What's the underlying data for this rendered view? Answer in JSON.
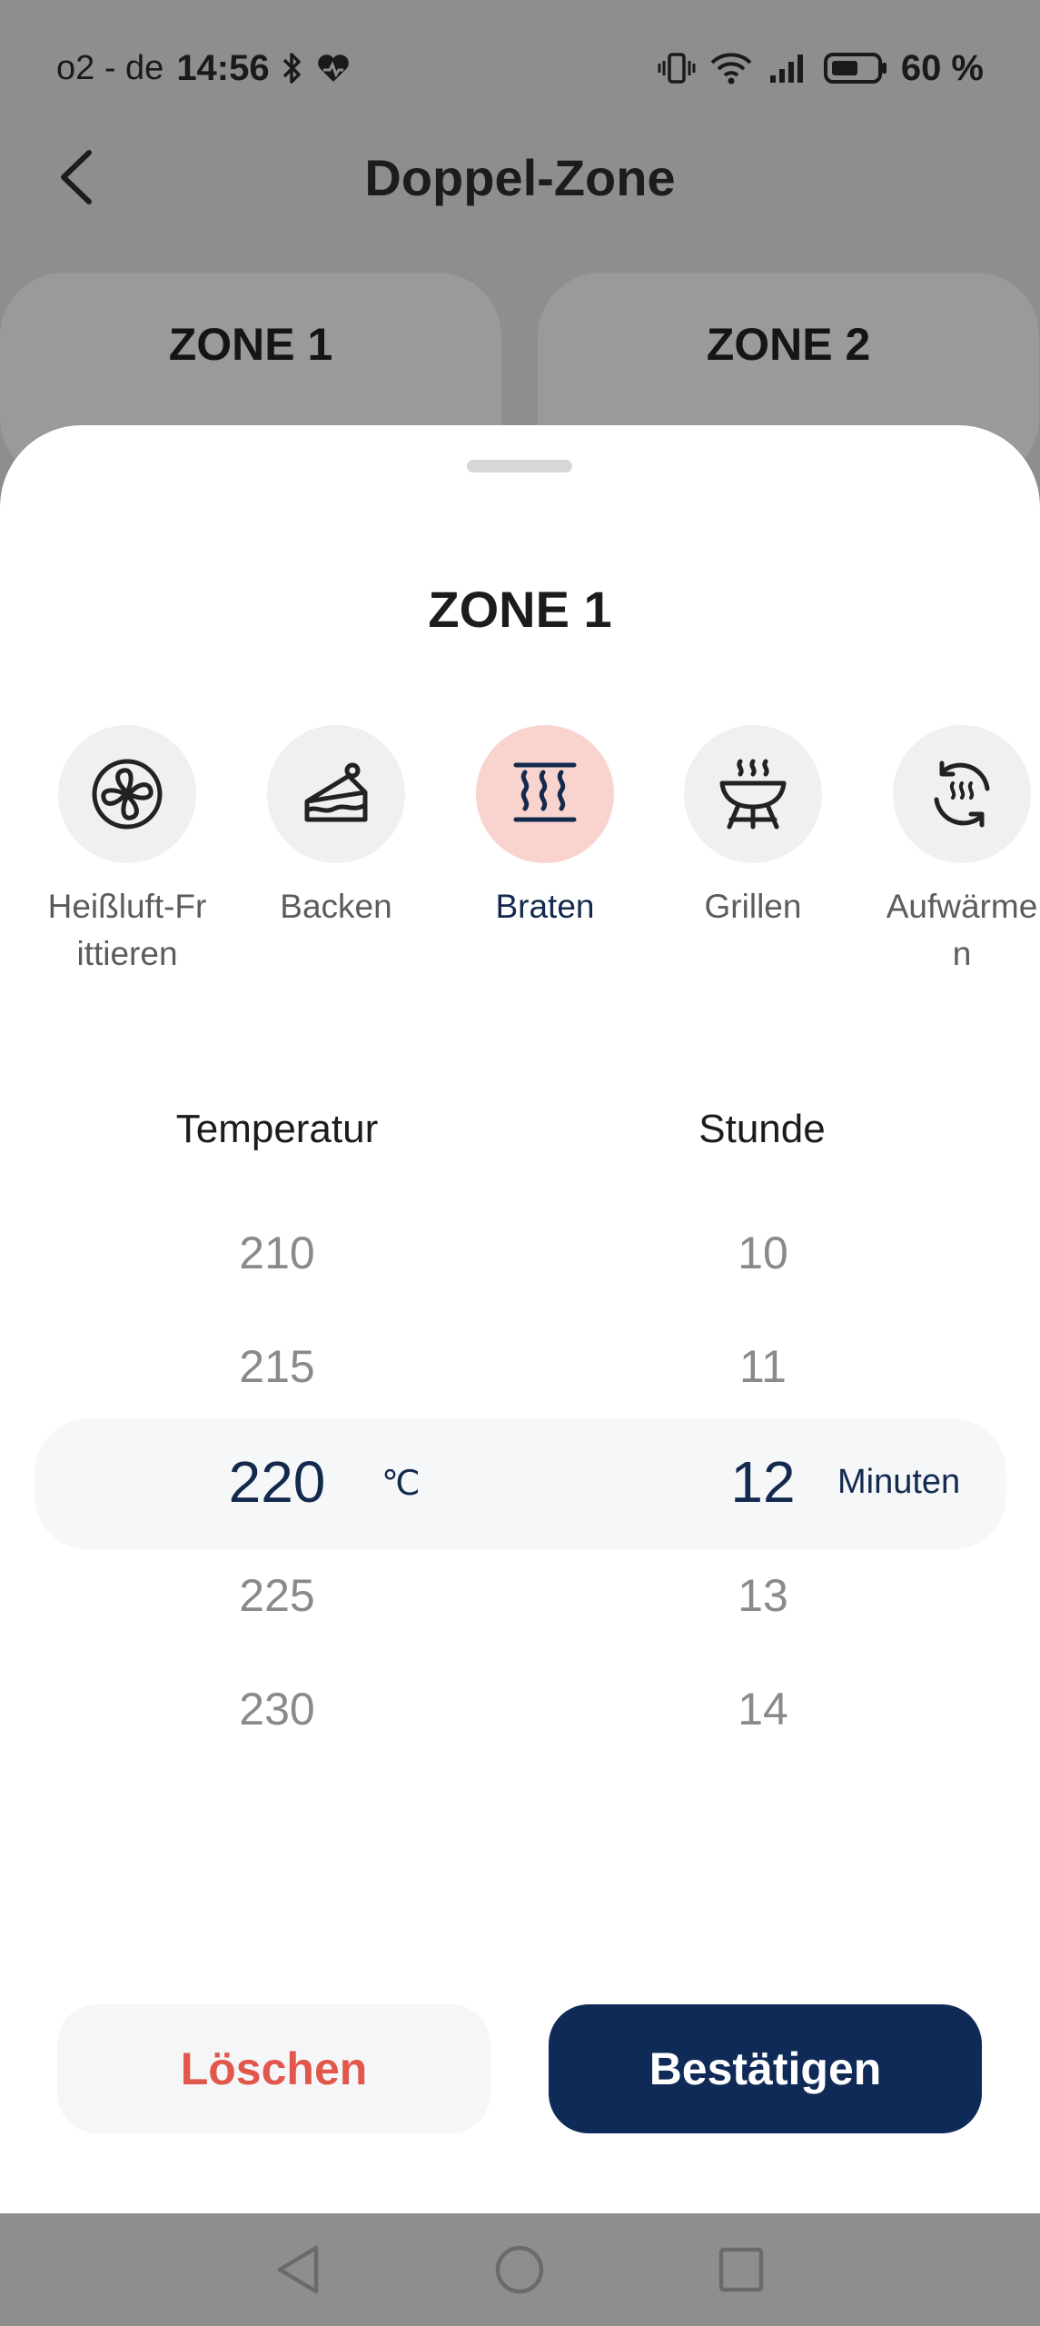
{
  "status_bar": {
    "carrier": "o2 - de",
    "time": "14:56",
    "battery": "60 %",
    "icons": [
      "bluetooth-icon",
      "health-icon",
      "vibrate-icon",
      "wifi-icon",
      "signal-icon",
      "battery-icon"
    ]
  },
  "header": {
    "title": "Doppel-Zone",
    "back_icon": "chevron-left-icon"
  },
  "zone_tabs": [
    {
      "label": "ZONE 1"
    },
    {
      "label": "ZONE 2"
    }
  ],
  "sheet": {
    "title": "ZONE 1",
    "modes": [
      {
        "label": "Heißluft-Fr\nittieren",
        "icon": "fan-icon",
        "active": false
      },
      {
        "label": "Backen",
        "icon": "cake-icon",
        "active": false
      },
      {
        "label": "Braten",
        "icon": "heat-waves-icon",
        "active": true
      },
      {
        "label": "Grillen",
        "icon": "grill-icon",
        "active": false
      },
      {
        "label": "Aufwärme\nn",
        "icon": "reheat-icon",
        "active": false
      }
    ],
    "temperature": {
      "label": "Temperatur",
      "values": [
        "210",
        "215",
        "220",
        "225",
        "230"
      ],
      "selected": "220",
      "unit": "℃"
    },
    "time": {
      "label": "Stunde",
      "values": [
        "10",
        "11",
        "12",
        "13",
        "14"
      ],
      "selected": "12",
      "unit": "Minuten"
    },
    "buttons": {
      "clear": "Löschen",
      "confirm": "Bestätigen"
    }
  },
  "colors": {
    "accent_navy": "#0f2a57",
    "active_mode_bg": "#f9d3cd",
    "clear_text": "#e2574c",
    "overlay": "#8e8e8e"
  }
}
